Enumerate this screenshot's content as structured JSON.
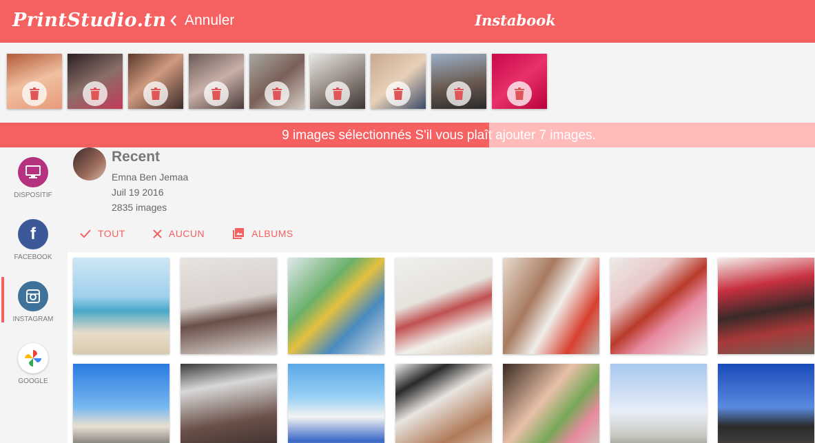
{
  "header": {
    "logo": "PrintStudio.tn",
    "back_label": "Annuler",
    "title": "Instabook"
  },
  "selection": {
    "message": "9 images sélectionnés S'il vous plaît ajouter 7 images.",
    "progress": 0.6
  },
  "sidebar": [
    {
      "label": "DISPOSITIF",
      "icon": "monitor-icon",
      "color": "#b5327f"
    },
    {
      "label": "FACEBOOK",
      "icon": "facebook-icon",
      "color": "#3b5998"
    },
    {
      "label": "INSTAGRAM",
      "icon": "instagram-icon",
      "color": "#3f729b",
      "active": true
    },
    {
      "label": "GOOGLE",
      "icon": "google-photos-icon",
      "color": "#ffffff"
    }
  ],
  "album": {
    "name": "Recent",
    "owner": "Emna Ben Jemaa",
    "date": "Juil 19 2016",
    "count": "2835 images"
  },
  "actions": [
    {
      "label": "TOUT",
      "icon": "check-icon"
    },
    {
      "label": "AUCUN",
      "icon": "close-icon"
    },
    {
      "label": "ALBUMS",
      "icon": "photo-library-icon"
    }
  ],
  "colors": {
    "accent": "#f56060",
    "banner_rest": "#ffbaba"
  }
}
